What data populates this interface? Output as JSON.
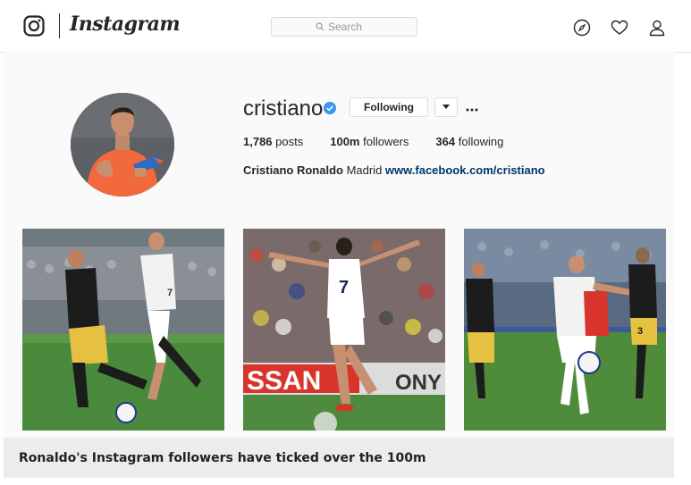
{
  "header": {
    "brand": "Instagram",
    "search_placeholder": "Search",
    "icons": [
      "instagram-logo-icon",
      "search-icon",
      "compass-icon",
      "heart-icon",
      "user-icon"
    ]
  },
  "profile": {
    "username": "cristiano",
    "verified": true,
    "follow_label": "Following",
    "stats": {
      "posts_count": "1,786",
      "posts_label": " posts",
      "followers_count": "100m",
      "followers_label": " followers",
      "following_count": "364",
      "following_label": " following"
    },
    "bio": {
      "name": "Cristiano Ronaldo",
      "location": " Madrid ",
      "link": "www.facebook.com/cristiano"
    }
  },
  "posts": {
    "post2_banner": "SSAN",
    "post2_banner2": "ONY",
    "jersey_number_1": "7",
    "jersey_number_2": "7",
    "jersey_number_3": "3"
  },
  "caption": "Ronaldo's Instagram followers have ticked over the 100m",
  "colors": {
    "accent_link": "#003569",
    "verified_blue": "#3897f0",
    "caption_bg": "#ececec"
  }
}
